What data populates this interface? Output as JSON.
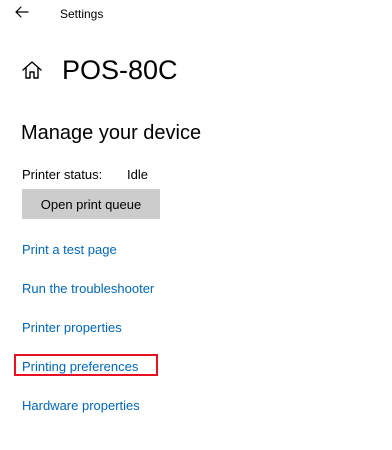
{
  "titlebar": {
    "back_icon": "arrow-left-icon",
    "app_title": "Settings"
  },
  "header": {
    "icon": "home-icon",
    "title": "POS-80C"
  },
  "section": {
    "heading": "Manage your device",
    "status_label": "Printer status:",
    "status_value": "Idle",
    "queue_button_label": "Open print queue"
  },
  "links": {
    "print_test_page": "Print a test page",
    "run_troubleshooter": "Run the troubleshooter",
    "printer_properties": "Printer properties",
    "printing_preferences": "Printing preferences",
    "hardware_properties": "Hardware properties"
  },
  "colors": {
    "link": "#0067b8",
    "button_bg": "#cccccc",
    "highlight": "#e81123"
  }
}
